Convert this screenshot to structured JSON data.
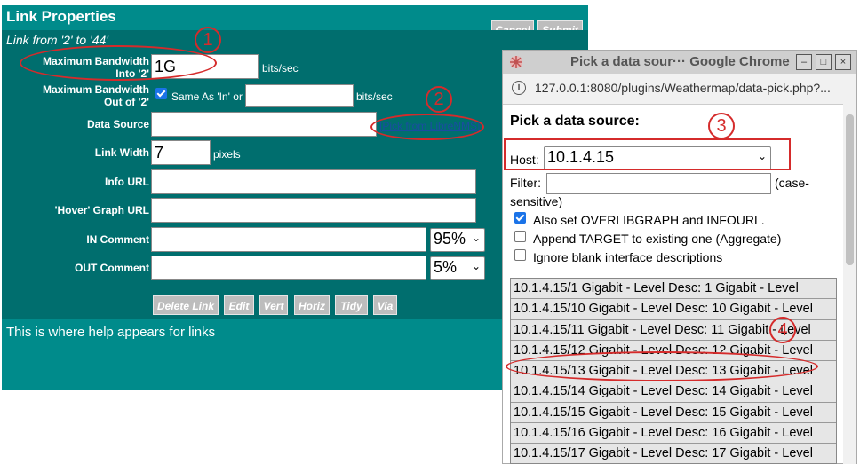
{
  "link_panel": {
    "title": "Link Properties",
    "cancel_label": "Cancel",
    "submit_label": "Submit",
    "subtitle": "Link from '2' to '44'",
    "max_bw_in_label": "Maximum Bandwidth Into '2'",
    "max_bw_in_label_l1": "Maximum Bandwidth",
    "max_bw_in_label_l2": "Into '2'",
    "max_bw_in_value": "1G",
    "max_bw_in_unit": "bits/sec",
    "max_bw_out_label_l1": "Maximum Bandwidth",
    "max_bw_out_label_l2": "Out of '2'",
    "same_as_in_label": "Same As 'In' or",
    "max_bw_out_value": "",
    "max_bw_out_unit": "bits/sec",
    "data_source_label": "Data Source",
    "data_source_value": "",
    "pick_link": "[Pick from LibreNMS]",
    "link_width_label": "Link Width",
    "link_width_value": "7",
    "link_width_unit": "pixels",
    "info_url_label": "Info URL",
    "hover_graph_label": "'Hover' Graph URL",
    "in_comment_label": "IN Comment",
    "in_comment_select": "95%",
    "out_comment_label": "OUT Comment",
    "out_comment_select": "5%",
    "buttons": [
      "Delete Link",
      "Edit",
      "Vert",
      "Horiz",
      "Tidy",
      "Via"
    ],
    "help_text": "This is where help appears for links"
  },
  "popup": {
    "window_title": "Pick a data sour··· Google Chrome",
    "url": "127.0.0.1:8080/plugins/Weathermap/data-pick.php?...",
    "heading": "Pick a data source:",
    "host_label": "Host:",
    "host_value": "10.1.4.15",
    "filter_label": "Filter:",
    "filter_value": "",
    "filter_hint_1": "(case-",
    "filter_hint_2": "sensitive)",
    "opt_overlib": "Also set OVERLIBGRAPH and INFOURL.",
    "opt_append": "Append TARGET to existing one (Aggregate)",
    "opt_ignore": "Ignore blank interface descriptions",
    "items": [
      "10.1.4.15/1 Gigabit - Level Desc: 1 Gigabit - Level",
      "10.1.4.15/10 Gigabit - Level Desc: 10 Gigabit - Level",
      "10.1.4.15/11 Gigabit - Level Desc: 11 Gigabit - Level",
      "10.1.4.15/12 Gigabit - Level Desc: 12 Gigabit - Level",
      "10.1.4.15/13 Gigabit - Level Desc: 13 Gigabit - Level",
      "10.1.4.15/14 Gigabit - Level Desc: 14 Gigabit - Level",
      "10.1.4.15/15 Gigabit - Level Desc: 15 Gigabit - Level",
      "10.1.4.15/16 Gigabit - Level Desc: 16 Gigabit - Level",
      "10.1.4.15/17 Gigabit - Level Desc: 17 Gigabit - Level"
    ]
  },
  "annotations": {
    "n1": "1",
    "n2": "2",
    "n3": "3",
    "n4": "4"
  },
  "colors": {
    "panel_bg": "#008b8b",
    "form_bg": "#006e6e",
    "annotation": "#d52b2b"
  }
}
